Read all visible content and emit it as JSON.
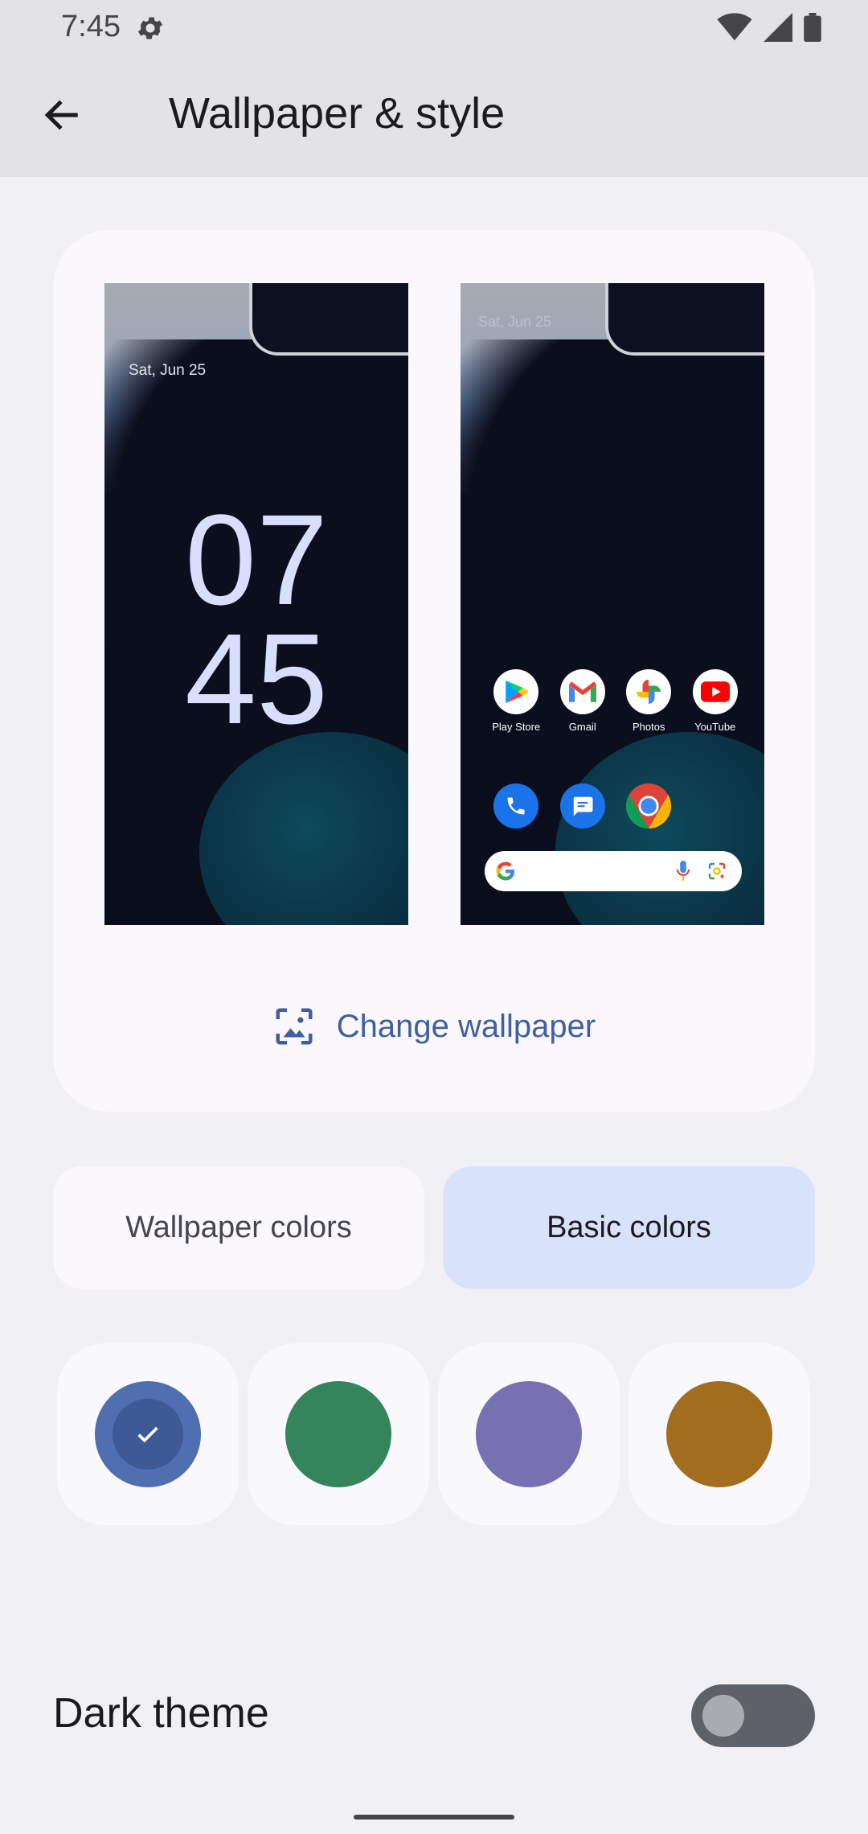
{
  "status_bar": {
    "time": "7:45"
  },
  "app_bar": {
    "title": "Wallpaper & style"
  },
  "preview": {
    "lock": {
      "date": "Sat, Jun 25",
      "hour": "07",
      "minute": "45"
    },
    "home": {
      "date": "Sat, Jun 25",
      "apps": [
        "Play Store",
        "Gmail",
        "Photos",
        "YouTube"
      ]
    },
    "change_wallpaper_label": "Change wallpaper"
  },
  "color_tabs": {
    "wallpaper": "Wallpaper colors",
    "basic": "Basic colors",
    "selected": "basic"
  },
  "swatches": [
    {
      "color": "#4f6fb0",
      "inner": "#3d5a96",
      "selected": true
    },
    {
      "color": "#35855c",
      "selected": false
    },
    {
      "color": "#7770b1",
      "selected": false
    },
    {
      "color": "#a36d20",
      "selected": false
    }
  ],
  "dark_theme": {
    "label": "Dark theme",
    "enabled": false
  }
}
